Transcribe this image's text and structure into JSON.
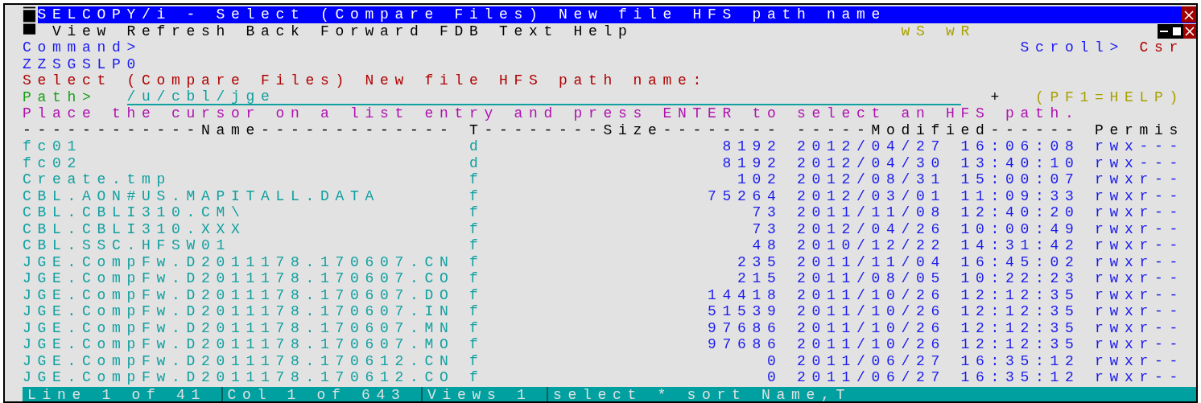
{
  "window": {
    "title": "SELCOPY/i - Select (Compare Files) New file HFS path name"
  },
  "menu": [
    "View",
    "Refresh",
    "Back",
    "Forward",
    "FDB",
    "Text",
    "Help"
  ],
  "window_indicators": [
    "wS",
    "wR"
  ],
  "command": {
    "label": "Command>"
  },
  "scroll": {
    "label": "Scroll>",
    "value": "Csr"
  },
  "panel_id": "ZZSGSLP0",
  "prompt": "Select (Compare Files) New file HFS path name:",
  "path": {
    "label": "Path>",
    "value": "/u/cbl/jge",
    "marker": "+",
    "help": "(PF1=HELP)"
  },
  "instruction": "Place the cursor on a list entry and press ENTER to select an HFS path.",
  "table": {
    "columns": [
      "------------Name-------------",
      "T",
      "--------Size--------",
      "-----Modified------",
      "Permis"
    ],
    "rows": [
      {
        "name": "fc01",
        "type": "d",
        "size": "8192",
        "date": "2012/04/27",
        "time": "16:06:08",
        "perms": "rwx---"
      },
      {
        "name": "fc02",
        "type": "d",
        "size": "8192",
        "date": "2012/04/30",
        "time": "13:40:10",
        "perms": "rwx---"
      },
      {
        "name": "Create.tmp",
        "type": "f",
        "size": "102",
        "date": "2012/08/31",
        "time": "15:00:07",
        "perms": "rwxr--"
      },
      {
        "name": "CBL.AON#US.MAPITALL.DATA",
        "type": "f",
        "size": "75264",
        "date": "2012/03/01",
        "time": "11:09:33",
        "perms": "rwxr--"
      },
      {
        "name": "CBL.CBLI310.CM\\",
        "type": "f",
        "size": "73",
        "date": "2011/11/08",
        "time": "12:40:20",
        "perms": "rwxr--"
      },
      {
        "name": "CBL.CBLI310.XXX",
        "type": "f",
        "size": "73",
        "date": "2012/04/26",
        "time": "10:00:49",
        "perms": "rwxr--"
      },
      {
        "name": "CBL.SSC.HFSW01",
        "type": "f",
        "size": "48",
        "date": "2010/12/22",
        "time": "14:31:42",
        "perms": "rwxr--"
      },
      {
        "name": "JGE.CompFw.D2011178.170607.CN",
        "type": "f",
        "size": "235",
        "date": "2011/11/04",
        "time": "16:45:02",
        "perms": "rwxr--"
      },
      {
        "name": "JGE.CompFw.D2011178.170607.CO",
        "type": "f",
        "size": "215",
        "date": "2011/08/05",
        "time": "10:22:23",
        "perms": "rwxr--"
      },
      {
        "name": "JGE.CompFw.D2011178.170607.DO",
        "type": "f",
        "size": "14418",
        "date": "2011/10/26",
        "time": "12:12:35",
        "perms": "rwxr--"
      },
      {
        "name": "JGE.CompFw.D2011178.170607.IN",
        "type": "f",
        "size": "51539",
        "date": "2011/10/26",
        "time": "12:12:35",
        "perms": "rwxr--"
      },
      {
        "name": "JGE.CompFw.D2011178.170607.MN",
        "type": "f",
        "size": "97686",
        "date": "2011/10/26",
        "time": "12:12:35",
        "perms": "rwxr--"
      },
      {
        "name": "JGE.CompFw.D2011178.170607.MO",
        "type": "f",
        "size": "97686",
        "date": "2011/10/26",
        "time": "12:12:35",
        "perms": "rwxr--"
      },
      {
        "name": "JGE.CompFw.D2011178.170612.CN",
        "type": "f",
        "size": "0",
        "date": "2011/06/27",
        "time": "16:35:12",
        "perms": "rwxr--"
      },
      {
        "name": "JGE.CompFw.D2011178.170612.CO",
        "type": "f",
        "size": "0",
        "date": "2011/06/27",
        "time": "16:35:12",
        "perms": "rwxr--"
      }
    ]
  },
  "status_bar": [
    "Line 1 of 41",
    "Col 1 of 643",
    "Views 1",
    "select * sort Name,T"
  ]
}
